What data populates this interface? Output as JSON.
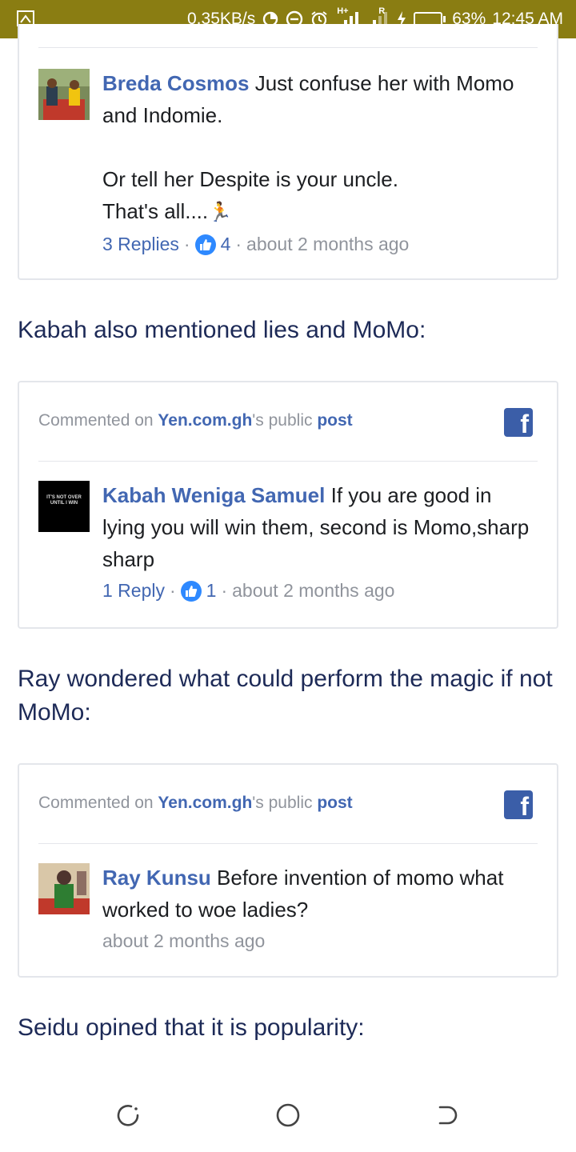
{
  "status_bar": {
    "speed": "0.35KB/s",
    "network_h": "H+",
    "network_r": "R",
    "battery_percent": "63%",
    "battery_level": 0.63,
    "time": "12:45 AM"
  },
  "comment_1": {
    "name": "Breda Cosmos",
    "text_line1": " Just confuse her with Momo and Indomie.",
    "text_line2": "Or tell her Despite is your uncle.",
    "text_line3": "That's all....",
    "emoji": "🏃",
    "replies": "3 Replies",
    "likes": "4",
    "time": "about 2 months ago"
  },
  "heading_1": "Kabah also mentioned lies and MoMo:",
  "card_2": {
    "commented_on": "Commented on ",
    "page": "Yen.com.gh",
    "public": "'s public ",
    "post": "post",
    "name": "Kabah Weniga Samuel",
    "text": " If you are good in lying you will win them, second is Momo,sharp sharp",
    "avatar_text": "IT'S NOT OVER UNTIL I WIN",
    "replies": "1 Reply",
    "likes": "1",
    "time": "about 2 months ago"
  },
  "heading_2": "Ray wondered what could perform the magic if not MoMo:",
  "card_3": {
    "commented_on": "Commented on ",
    "page": "Yen.com.gh",
    "public": "'s public ",
    "post": "post",
    "name": "Ray Kunsu",
    "text": " Before invention of momo what worked to woe ladies?",
    "time": "about 2 months ago"
  },
  "heading_3": "Seidu opined that it is popularity:",
  "colors": {
    "status_bar": "#8a7d12",
    "link": "#4267b2",
    "heading": "#1d2a57",
    "meta": "#90949c",
    "like": "#2e89ff"
  }
}
